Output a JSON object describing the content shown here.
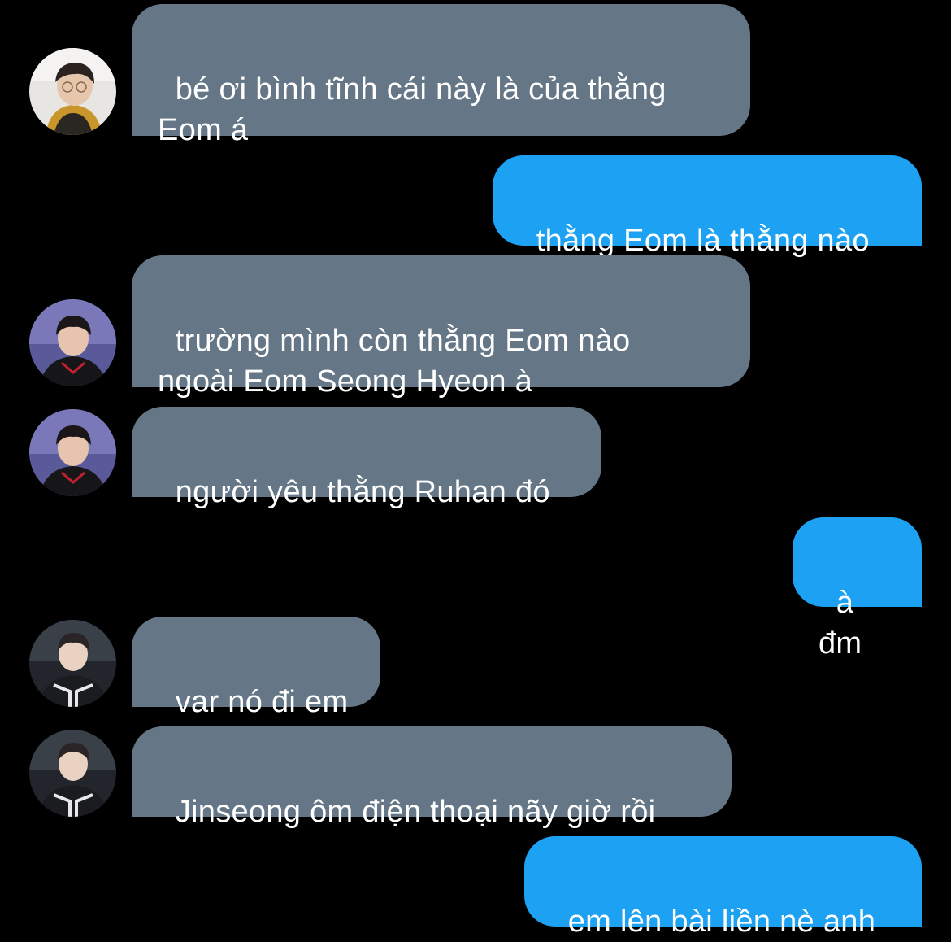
{
  "colors": {
    "background": "#000000",
    "incoming_bubble": "#657786",
    "outgoing_bubble": "#1da1f2",
    "text": "#ffffff"
  },
  "messages": [
    {
      "side": "incoming",
      "avatar": "avatar-photo-1",
      "text": "bé ơi bình tĩnh cái này là của thằng\nEom á"
    },
    {
      "side": "outgoing",
      "text": "thằng Eom là thằng nào"
    },
    {
      "side": "incoming",
      "avatar": "avatar-photo-2",
      "text": "trường mình còn thằng Eom nào\nngoài Eom Seong Hyeon à"
    },
    {
      "side": "incoming",
      "avatar": "avatar-photo-2",
      "text": "người yêu thằng Ruhan đó"
    },
    {
      "side": "outgoing",
      "text": "à đm"
    },
    {
      "side": "incoming",
      "avatar": "avatar-photo-3",
      "text": "var nó đi em"
    },
    {
      "side": "incoming",
      "avatar": "avatar-photo-3",
      "text": "Jinseong ôm điện thoại nãy giờ rồi"
    },
    {
      "side": "outgoing",
      "text": "em lên bài liền nè anh"
    }
  ]
}
